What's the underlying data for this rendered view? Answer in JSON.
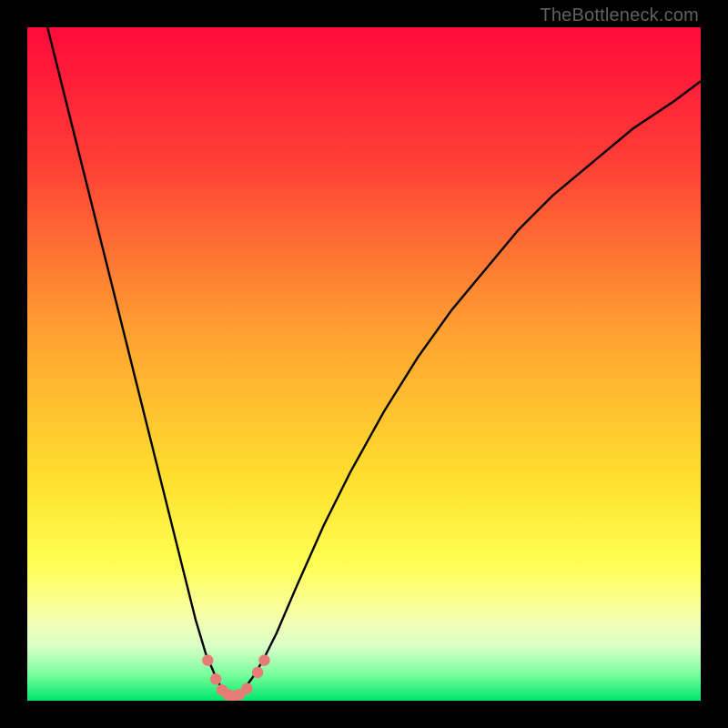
{
  "watermark": "TheBottleneck.com",
  "chart_data": {
    "type": "line",
    "title": "",
    "xlabel": "",
    "ylabel": "",
    "xlim": [
      0,
      100
    ],
    "ylim": [
      0,
      100
    ],
    "gradient_stops": [
      {
        "offset": 0,
        "color": "#ff0a3a"
      },
      {
        "offset": 20,
        "color": "#ff3e36"
      },
      {
        "offset": 45,
        "color": "#ffa031"
      },
      {
        "offset": 68,
        "color": "#ffe22e"
      },
      {
        "offset": 80,
        "color": "#ffff55"
      },
      {
        "offset": 88,
        "color": "#f5ffb0"
      },
      {
        "offset": 92,
        "color": "#d8ffc8"
      },
      {
        "offset": 96,
        "color": "#7dff9e"
      },
      {
        "offset": 100,
        "color": "#00e66a"
      }
    ],
    "series": [
      {
        "name": "bottleneck-curve",
        "x": [
          3,
          5,
          7,
          9,
          11,
          13,
          15,
          17,
          19,
          21,
          23,
          25,
          26.5,
          28,
          29,
          30,
          30.8,
          32,
          33.5,
          35,
          37,
          40,
          44,
          48,
          53,
          58,
          63,
          68,
          73,
          78,
          84,
          90,
          96,
          100
        ],
        "y": [
          100,
          92,
          84,
          76,
          68,
          60,
          52,
          44,
          36,
          28,
          20,
          12,
          7,
          3.5,
          1.5,
          0.5,
          0.5,
          1.5,
          3.5,
          6,
          10,
          17,
          26,
          34,
          43,
          51,
          58,
          64,
          70,
          75,
          80,
          85,
          89,
          92
        ]
      }
    ],
    "markers": {
      "name": "highlight-dots",
      "color": "#e77c76",
      "points": [
        {
          "x": 26.8,
          "y": 6.0
        },
        {
          "x": 28.0,
          "y": 3.2
        },
        {
          "x": 28.9,
          "y": 1.6
        },
        {
          "x": 29.8,
          "y": 0.9
        },
        {
          "x": 30.6,
          "y": 0.7
        },
        {
          "x": 31.5,
          "y": 0.9
        },
        {
          "x": 32.6,
          "y": 1.8
        },
        {
          "x": 34.2,
          "y": 4.2
        },
        {
          "x": 35.2,
          "y": 6.0
        }
      ]
    }
  }
}
